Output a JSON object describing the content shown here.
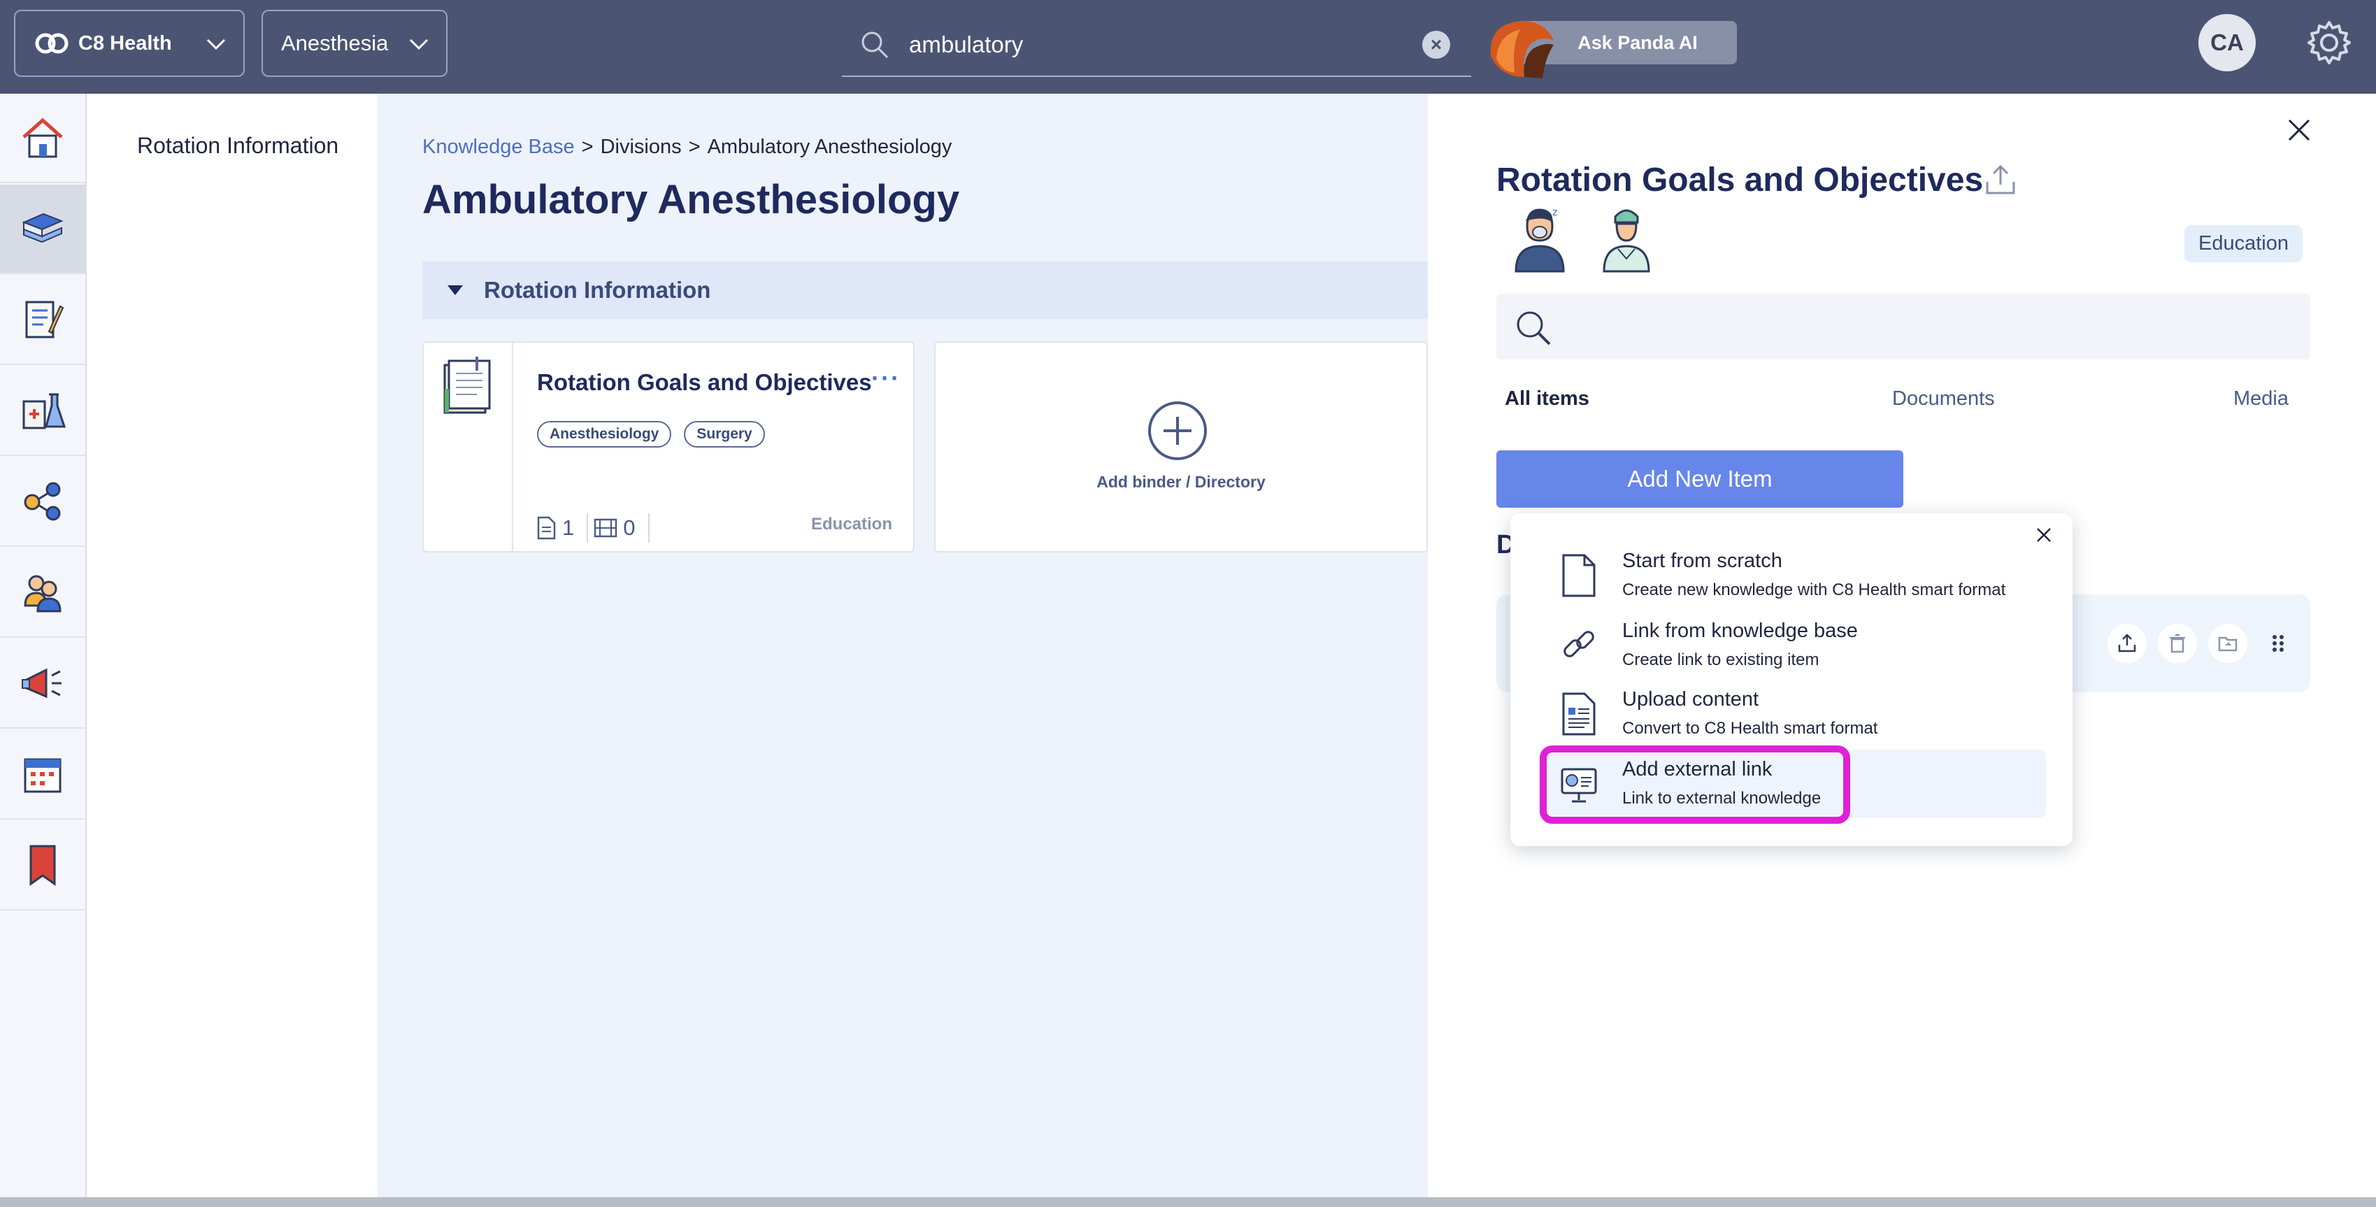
{
  "topbar": {
    "org": "C8 Health",
    "department": "Anesthesia",
    "search_value": "ambulatory",
    "ask_ai": "Ask Panda AI",
    "avatar_initials": "CA"
  },
  "leftnav": {
    "items": [
      "home-icon",
      "knowledge-base-icon",
      "checklist-icon",
      "lab-icon",
      "network-icon",
      "users-icon",
      "announcements-icon",
      "calendar-icon",
      "bookmark-icon"
    ],
    "active_index": 1
  },
  "subnav": {
    "item": "Rotation Information"
  },
  "main": {
    "breadcrumb": [
      "Knowledge Base",
      "Divisions",
      "Ambulatory Anesthesiology"
    ],
    "breadcrumb_sep": ">",
    "title": "Ambulatory Anesthesiology",
    "section": "Rotation Information",
    "card": {
      "title": "Rotation Goals and Objectives",
      "more": "···",
      "tags": [
        "Anesthesiology",
        "Surgery"
      ],
      "doc_count": "1",
      "media_count": "0",
      "category": "Education"
    },
    "add_card_label": "Add binder / Directory"
  },
  "panel": {
    "title": "Rotation Goals and Objectives",
    "badge": "Education",
    "tabs": [
      "All items",
      "Documents",
      "Media"
    ],
    "add_new": "Add New Item",
    "section_fragment": "D"
  },
  "popup": {
    "options": [
      {
        "title": "Start from scratch",
        "subtitle": "Create new knowledge with C8 Health smart format",
        "icon": "blank-document-icon"
      },
      {
        "title": "Link from knowledge base",
        "subtitle": "Create link to existing item",
        "icon": "chain-link-icon"
      },
      {
        "title": "Upload content",
        "subtitle": "Convert to C8 Health smart format",
        "icon": "uploaded-document-icon"
      },
      {
        "title": "Add external link",
        "subtitle": "Link to external knowledge",
        "icon": "external-site-icon"
      }
    ],
    "highlighted_index": 3
  },
  "colors": {
    "topbar": "#4b5573",
    "primary": "#6686ea",
    "title": "#1e2a5e",
    "focus_ring": "#e020d6"
  }
}
